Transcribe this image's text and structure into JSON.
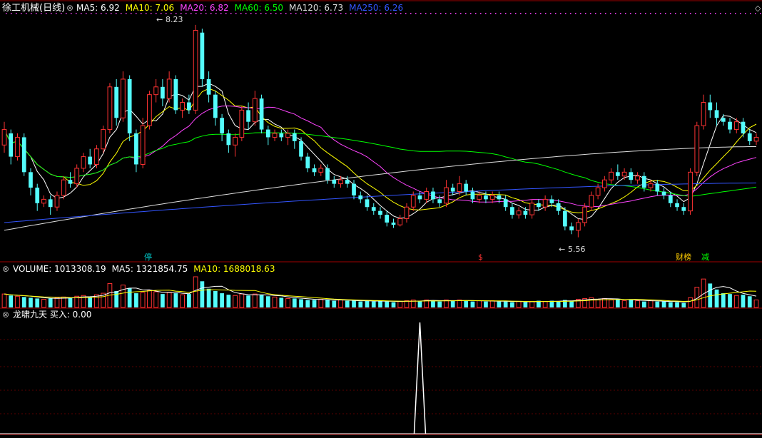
{
  "price_panel": {
    "stock_name": "徐工机械(日线)",
    "indicators": [
      {
        "label": "MA5: 6.92",
        "color": "#ffffff"
      },
      {
        "label": "MA10: 7.06",
        "color": "#ffff00"
      },
      {
        "label": "MA20: 6.82",
        "color": "#ff44ff"
      },
      {
        "label": "MA60: 6.50",
        "color": "#00ff00"
      },
      {
        "label": "MA120: 6.73",
        "color": "#dddddd"
      },
      {
        "label": "MA250: 6.26",
        "color": "#3355ff"
      }
    ],
    "high_label": "8.23",
    "low_label": "5.56",
    "markers": [
      {
        "text": "停",
        "color": "#00cccc"
      },
      {
        "text": "$",
        "color": "#ff3333"
      },
      {
        "text": "财榜",
        "color": "#ffcc00"
      },
      {
        "text": "减",
        "color": "#00ff00"
      }
    ]
  },
  "volume_panel": {
    "indicators": [
      {
        "label": "VOLUME: 1013308.19",
        "color": "#ffffff"
      },
      {
        "label": "MA5: 1321854.75",
        "color": "#ffffff"
      },
      {
        "label": "MA10: 1688018.63",
        "color": "#ffff00"
      }
    ]
  },
  "signal_panel": {
    "indicators": [
      {
        "label": "龙啸九天 买入: 0.00",
        "color": "#ffffff"
      }
    ]
  },
  "colors": {
    "up": "#ff3333",
    "down": "#54fcfc",
    "panel_border": "#a00000",
    "grid": "#5a0000"
  },
  "chart_data": [
    {
      "type": "candlestick",
      "price_range": [
        5.4,
        8.4
      ],
      "candles": [
        [
          6.75,
          6.95,
          7.05,
          6.65
        ],
        [
          6.9,
          6.6,
          6.95,
          6.5
        ],
        [
          6.6,
          6.85,
          6.9,
          6.55
        ],
        [
          6.85,
          6.4,
          6.9,
          6.35
        ],
        [
          6.4,
          6.2,
          6.45,
          6.1
        ],
        [
          6.2,
          6.0,
          6.25,
          5.9
        ],
        [
          6.0,
          6.05,
          6.1,
          5.95
        ],
        [
          6.05,
          5.95,
          6.1,
          5.85
        ],
        [
          5.95,
          6.1,
          6.15,
          5.9
        ],
        [
          6.1,
          6.3,
          6.35,
          6.05
        ],
        [
          6.3,
          6.25,
          6.4,
          6.2
        ],
        [
          6.25,
          6.45,
          6.5,
          6.2
        ],
        [
          6.45,
          6.6,
          6.65,
          6.4
        ],
        [
          6.6,
          6.5,
          6.7,
          6.45
        ],
        [
          6.5,
          6.7,
          6.75,
          6.45
        ],
        [
          6.7,
          6.95,
          7.0,
          6.65
        ],
        [
          6.95,
          7.5,
          7.55,
          6.9
        ],
        [
          7.5,
          7.1,
          7.6,
          7.0
        ],
        [
          7.1,
          7.6,
          7.7,
          7.05
        ],
        [
          7.6,
          6.9,
          7.65,
          6.8
        ],
        [
          6.9,
          6.5,
          6.95,
          6.4
        ],
        [
          6.5,
          7.0,
          7.1,
          6.45
        ],
        [
          7.0,
          7.4,
          7.45,
          6.95
        ],
        [
          7.4,
          7.5,
          7.6,
          7.3
        ],
        [
          7.5,
          7.35,
          7.6,
          7.25
        ],
        [
          7.35,
          7.6,
          7.7,
          7.3
        ],
        [
          7.6,
          7.2,
          7.65,
          7.15
        ],
        [
          7.2,
          7.3,
          7.35,
          7.1
        ],
        [
          7.3,
          7.2,
          7.4,
          7.15
        ],
        [
          7.2,
          8.23,
          8.3,
          7.15
        ],
        [
          8.2,
          7.6,
          8.25,
          7.5
        ],
        [
          7.6,
          7.4,
          7.7,
          7.3
        ],
        [
          7.4,
          7.1,
          7.45,
          7.0
        ],
        [
          7.1,
          6.9,
          7.15,
          6.8
        ],
        [
          6.9,
          6.75,
          6.95,
          6.65
        ],
        [
          6.75,
          6.85,
          6.9,
          6.6
        ],
        [
          6.85,
          7.2,
          7.25,
          6.8
        ],
        [
          7.2,
          7.05,
          7.3,
          6.95
        ],
        [
          7.05,
          7.35,
          7.45,
          7.0
        ],
        [
          7.35,
          6.95,
          7.4,
          6.9
        ],
        [
          6.95,
          6.85,
          7.0,
          6.75
        ],
        [
          6.85,
          6.9,
          6.95,
          6.8
        ],
        [
          6.9,
          6.85,
          6.95,
          6.8
        ],
        [
          6.85,
          6.9,
          6.95,
          6.75
        ],
        [
          6.9,
          6.8,
          6.95,
          6.7
        ],
        [
          6.8,
          6.6,
          6.85,
          6.55
        ],
        [
          6.6,
          6.45,
          6.65,
          6.4
        ],
        [
          6.45,
          6.4,
          6.5,
          6.35
        ],
        [
          6.4,
          6.45,
          6.5,
          6.35
        ],
        [
          6.45,
          6.3,
          6.5,
          6.25
        ],
        [
          6.3,
          6.25,
          6.35,
          6.2
        ],
        [
          6.25,
          6.3,
          6.35,
          6.2
        ],
        [
          6.3,
          6.25,
          6.35,
          6.2
        ],
        [
          6.25,
          6.1,
          6.3,
          6.05
        ],
        [
          6.1,
          6.05,
          6.15,
          6.0
        ],
        [
          6.05,
          5.95,
          6.1,
          5.9
        ],
        [
          5.95,
          5.9,
          6.0,
          5.85
        ],
        [
          5.9,
          5.85,
          5.95,
          5.8
        ],
        [
          5.85,
          5.75,
          5.9,
          5.7
        ],
        [
          5.75,
          5.72,
          5.8,
          5.68
        ],
        [
          5.72,
          5.8,
          5.85,
          5.7
        ],
        [
          5.8,
          5.95,
          6.0,
          5.75
        ],
        [
          5.95,
          6.1,
          6.15,
          5.9
        ],
        [
          6.1,
          6.05,
          6.15,
          6.0
        ],
        [
          6.05,
          6.15,
          6.2,
          6.0
        ],
        [
          6.15,
          6.05,
          6.2,
          6.0
        ],
        [
          6.05,
          6.0,
          6.1,
          5.95
        ],
        [
          6.0,
          6.2,
          6.3,
          5.95
        ],
        [
          6.2,
          6.15,
          6.25,
          6.1
        ],
        [
          6.15,
          6.25,
          6.35,
          6.1
        ],
        [
          6.25,
          6.15,
          6.3,
          6.1
        ],
        [
          6.15,
          6.05,
          6.2,
          6.0
        ],
        [
          6.05,
          6.1,
          6.15,
          6.0
        ],
        [
          6.1,
          6.05,
          6.15,
          6.0
        ],
        [
          6.05,
          6.1,
          6.15,
          6.0
        ],
        [
          6.1,
          6.05,
          6.15,
          6.0
        ],
        [
          6.05,
          5.95,
          6.1,
          5.9
        ],
        [
          5.95,
          5.85,
          6.0,
          5.8
        ],
        [
          5.85,
          5.9,
          5.95,
          5.8
        ],
        [
          5.9,
          5.85,
          5.95,
          5.8
        ],
        [
          5.85,
          6.0,
          6.05,
          5.8
        ],
        [
          6.0,
          5.95,
          6.05,
          5.9
        ],
        [
          5.95,
          6.05,
          6.1,
          5.9
        ],
        [
          6.05,
          6.0,
          6.1,
          5.95
        ],
        [
          6.0,
          5.9,
          6.05,
          5.85
        ],
        [
          5.9,
          5.7,
          5.95,
          5.65
        ],
        [
          5.7,
          5.65,
          5.75,
          5.6
        ],
        [
          5.65,
          5.75,
          5.8,
          5.56
        ],
        [
          5.75,
          5.95,
          6.0,
          5.7
        ],
        [
          5.95,
          6.1,
          6.15,
          5.9
        ],
        [
          6.1,
          6.2,
          6.25,
          6.05
        ],
        [
          6.2,
          6.3,
          6.35,
          6.15
        ],
        [
          6.3,
          6.4,
          6.45,
          6.25
        ],
        [
          6.4,
          6.35,
          6.5,
          6.3
        ],
        [
          6.35,
          6.4,
          6.45,
          6.3
        ],
        [
          6.4,
          6.3,
          6.45,
          6.25
        ],
        [
          6.3,
          6.35,
          6.4,
          6.25
        ],
        [
          6.35,
          6.2,
          6.4,
          6.15
        ],
        [
          6.2,
          6.25,
          6.3,
          6.15
        ],
        [
          6.25,
          6.15,
          6.3,
          6.1
        ],
        [
          6.15,
          6.1,
          6.2,
          6.05
        ],
        [
          6.1,
          6.0,
          6.15,
          5.95
        ],
        [
          6.0,
          5.95,
          6.05,
          5.9
        ],
        [
          5.95,
          5.9,
          6.0,
          5.85
        ],
        [
          5.9,
          6.4,
          6.45,
          5.85
        ],
        [
          6.4,
          7.0,
          7.05,
          6.35
        ],
        [
          7.0,
          7.3,
          7.4,
          6.95
        ],
        [
          7.3,
          7.2,
          7.4,
          7.1
        ],
        [
          7.2,
          7.1,
          7.3,
          7.0
        ],
        [
          7.1,
          7.05,
          7.15,
          7.0
        ],
        [
          7.05,
          6.95,
          7.1,
          6.9
        ],
        [
          6.95,
          7.05,
          7.1,
          6.9
        ],
        [
          7.05,
          6.9,
          7.1,
          6.85
        ],
        [
          6.9,
          6.8,
          6.95,
          6.75
        ],
        [
          6.8,
          6.85,
          6.9,
          6.75
        ]
      ],
      "volumes": [
        1.8,
        1.6,
        1.5,
        1.4,
        1.3,
        1.2,
        1.1,
        1.2,
        1.3,
        1.4,
        1.3,
        1.5,
        1.6,
        1.4,
        1.7,
        1.9,
        3.2,
        2.2,
        3.0,
        2.6,
        1.9,
        2.0,
        2.3,
        2.1,
        1.8,
        2.0,
        1.9,
        1.7,
        1.8,
        4.1,
        3.5,
        2.5,
        2.2,
        1.9,
        1.7,
        1.6,
        1.8,
        1.6,
        1.8,
        1.7,
        1.5,
        1.4,
        1.3,
        1.2,
        1.2,
        1.1,
        1.0,
        1.0,
        1.1,
        1.0,
        0.9,
        1.0,
        0.9,
        0.9,
        0.8,
        0.9,
        0.8,
        0.9,
        0.8,
        0.7,
        0.8,
        0.9,
        1.0,
        0.9,
        1.0,
        0.9,
        0.8,
        1.0,
        0.9,
        1.0,
        0.9,
        0.8,
        0.9,
        0.8,
        0.9,
        0.8,
        0.8,
        0.7,
        0.8,
        0.7,
        0.8,
        0.9,
        0.8,
        0.9,
        0.8,
        1.0,
        0.9,
        1.1,
        1.2,
        1.3,
        1.1,
        1.2,
        1.0,
        1.1,
        0.9,
        1.0,
        0.9,
        0.8,
        0.9,
        0.8,
        0.8,
        0.7,
        0.7,
        0.6,
        1.3,
        2.7,
        3.8,
        3.2,
        2.4,
        1.9,
        1.8,
        1.6,
        1.7,
        1.5,
        1.0
      ],
      "signal": {
        "peak_index": 63
      }
    }
  ]
}
